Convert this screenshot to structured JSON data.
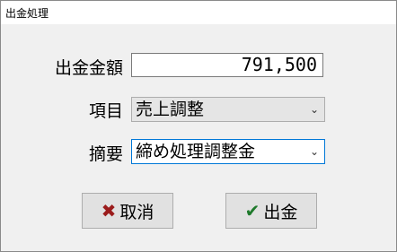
{
  "window": {
    "title": "出金処理"
  },
  "form": {
    "amount": {
      "label": "出金金額",
      "value": "791,500"
    },
    "item": {
      "label": "項目",
      "value": "売上調整"
    },
    "summary": {
      "label": "摘要",
      "value": "締め処理調整金"
    }
  },
  "buttons": {
    "cancel": {
      "label": "取消",
      "icon": "x-icon"
    },
    "withdraw": {
      "label": "出金",
      "icon": "check-icon"
    }
  },
  "colors": {
    "focus_border": "#0078d7",
    "cancel_icon": "#9b1c1c",
    "ok_icon": "#1f7a2c"
  }
}
